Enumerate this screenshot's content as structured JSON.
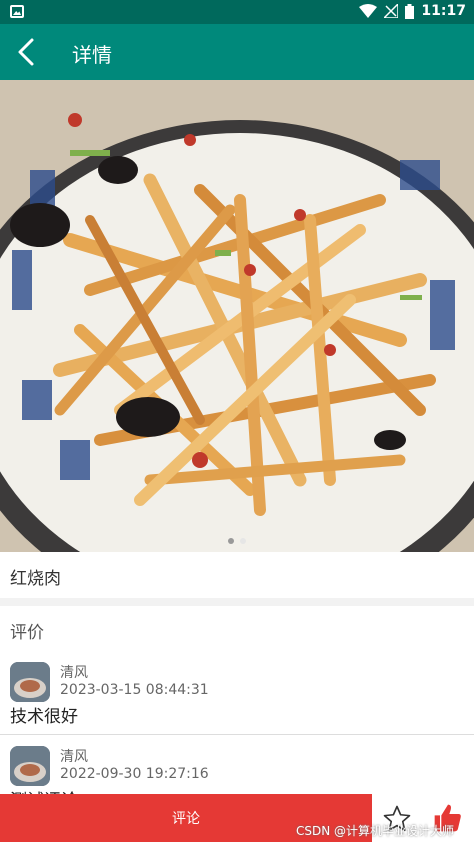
{
  "status_bar": {
    "time": "11:17"
  },
  "app_bar": {
    "title": "详情"
  },
  "detail": {
    "name": "红烧肉"
  },
  "reviews": {
    "heading": "评价",
    "items": [
      {
        "user": "清风",
        "time": "2023-03-15 08:44:31",
        "text": "技术很好"
      },
      {
        "user": "清风",
        "time": "2022-09-30 19:27:16",
        "text": "测试评论"
      }
    ]
  },
  "bottom_bar": {
    "comment_label": "评论"
  },
  "carousel": {
    "page_count": 2,
    "current_page": 1
  },
  "watermark": "CSDN @计算机毕业设计大师",
  "colors": {
    "primary": "#00897b",
    "primary_dark": "#00695c",
    "accent": "#e53935"
  }
}
